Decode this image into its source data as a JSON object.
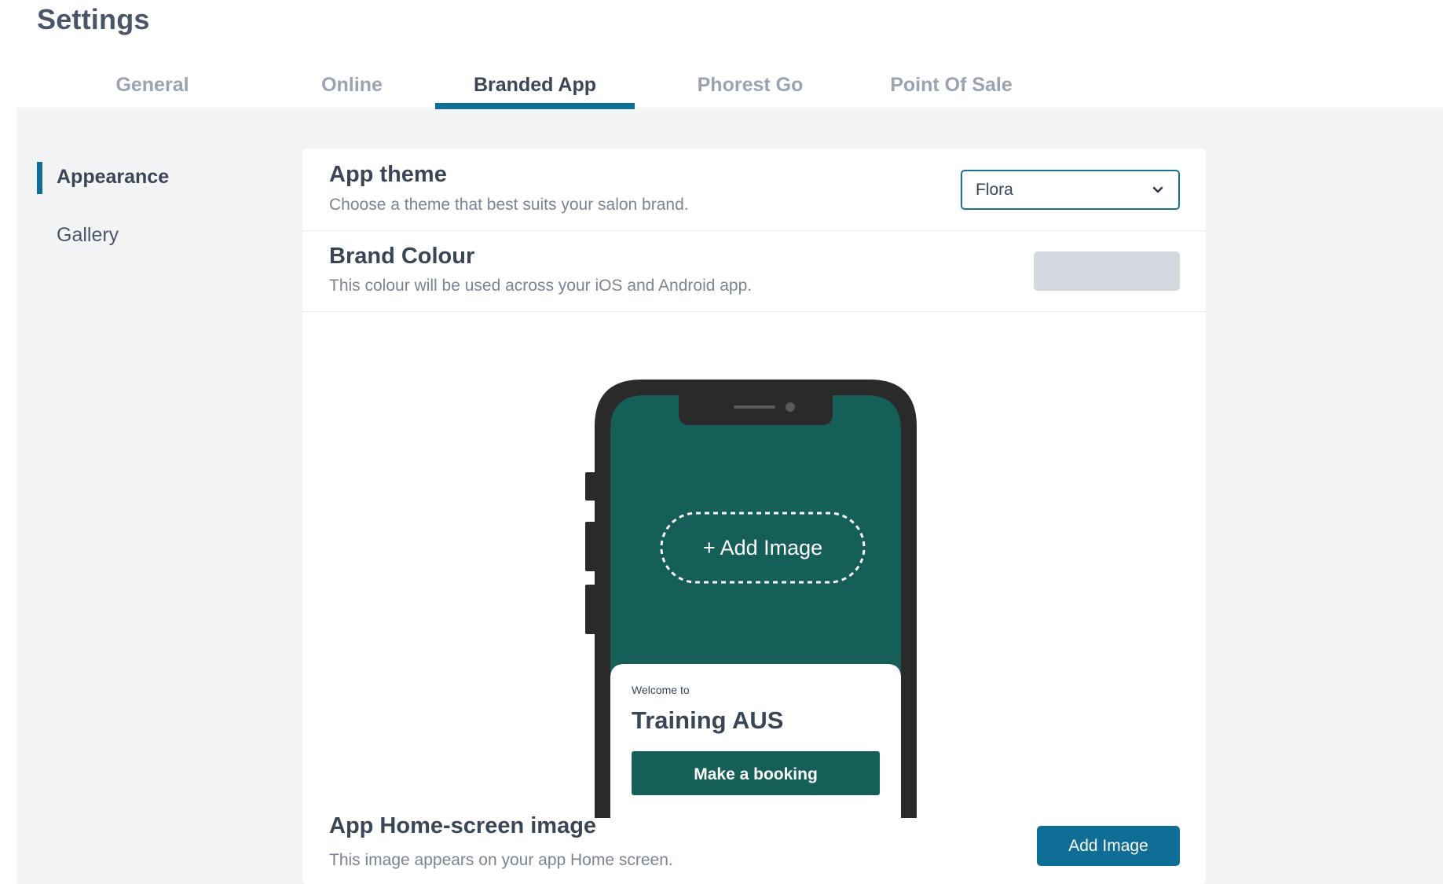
{
  "page": {
    "title": "Settings"
  },
  "tabs": [
    {
      "label": "General"
    },
    {
      "label": "Online"
    },
    {
      "label": "Branded App",
      "active": true
    },
    {
      "label": "Phorest Go"
    },
    {
      "label": "Point Of Sale"
    }
  ],
  "sidenav": [
    {
      "label": "Appearance",
      "active": true
    },
    {
      "label": "Gallery"
    }
  ],
  "app_theme": {
    "title": "App theme",
    "description": "Choose a theme that best suits your salon brand.",
    "selected": "Flora"
  },
  "brand_colour": {
    "title": "Brand Colour",
    "description": "This colour will be used across your iOS and Android app.",
    "swatch_color": "#d4d8df"
  },
  "phone_preview": {
    "add_image_label": "+ Add Image",
    "welcome_text": "Welcome to",
    "salon_name": "Training AUS",
    "booking_button": "Make a booking",
    "screen_color": "#155f58"
  },
  "home_screen_image": {
    "title": "App Home-screen image",
    "description": "This image appears on your app Home screen.",
    "button_label": "Add Image"
  },
  "colors": {
    "accent": "#0f6e96",
    "phone_frame": "#2a2a2a",
    "theme_green": "#155f58"
  }
}
